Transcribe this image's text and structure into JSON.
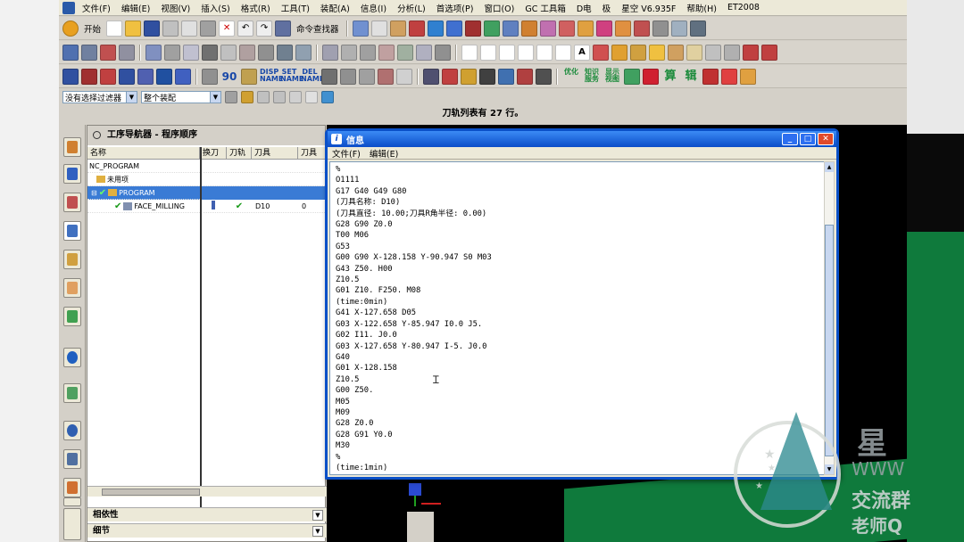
{
  "menubar": {
    "items": [
      "文件(F)",
      "编辑(E)",
      "视图(V)",
      "插入(S)",
      "格式(R)",
      "工具(T)",
      "装配(A)",
      "信息(I)",
      "分析(L)",
      "首选项(P)",
      "窗口(O)",
      "GC 工具箱",
      "D电",
      "极",
      "星空 V6.935F",
      "帮助(H)",
      "ET2008"
    ]
  },
  "toolbar1": {
    "start_label": "开始",
    "cmd_finder_label": "命令查找器"
  },
  "toolbar2": {
    "disp_name": "DISP NAME",
    "set_name": "SET NAME",
    "del_name": "DEL NAME",
    "num_90": "90",
    "text_a": "A"
  },
  "toolbar3": {
    "labels": [
      "优化",
      "知识服务",
      "显示视图",
      "算",
      "辑"
    ]
  },
  "filterbar": {
    "filter_value": "没有选择过滤器",
    "scope_value": "整个装配"
  },
  "statusline": {
    "text": "刀轨列表有 27 行。"
  },
  "navigator": {
    "title": "工序导航器 - 程序顺序",
    "columns": [
      "名称",
      "换刀",
      "刀轨",
      "刀具",
      "刀具"
    ],
    "rows": [
      {
        "name": "NC_PROGRAM",
        "tool": "",
        "num": ""
      },
      {
        "name": "未用项",
        "tool": "",
        "num": ""
      },
      {
        "name": "PROGRAM",
        "tool": "",
        "num": ""
      },
      {
        "name": "FACE_MILLING",
        "tool": "D10",
        "num": "0"
      }
    ],
    "panel_dependencies": "相依性",
    "panel_details": "细节"
  },
  "info_window": {
    "title": "信息",
    "menu": [
      "文件(F)",
      "编辑(E)"
    ],
    "lines": [
      "%",
      "O1111",
      "G17 G40 G49 G80",
      "(刀具名称: D10)",
      "(刀具直径: 10.00;刀具R角半径: 0.00)",
      "G28 G90 Z0.0",
      "T00 M06",
      "G53",
      "G00 G90 X-128.158 Y-90.947 S0 M03",
      "G43 Z50. H00",
      "Z10.5",
      "G01 Z10. F250. M08",
      "(time:0min)",
      "G41 X-127.658 D05",
      "G03 X-122.658 Y-85.947 I0.0 J5.",
      "G02 I11. J0.0",
      "G03 X-127.658 Y-80.947 I-5. J0.0",
      "G40",
      "G01 X-128.158",
      "Z10.5",
      "G00 Z50.",
      "M05",
      "M09",
      "G28 Z0.0",
      "G28 G91 Y0.0",
      "M30",
      "%",
      "(time:1min)"
    ]
  },
  "watermark": {
    "big": "星",
    "url": "WWW",
    "line1": "交流群",
    "line2": "老师Q"
  },
  "colors": {
    "titlebar": "#0a4cc8",
    "selection": "#3a7bd5",
    "check": "#1a9a1a",
    "background_green": "#0f7a3c"
  }
}
